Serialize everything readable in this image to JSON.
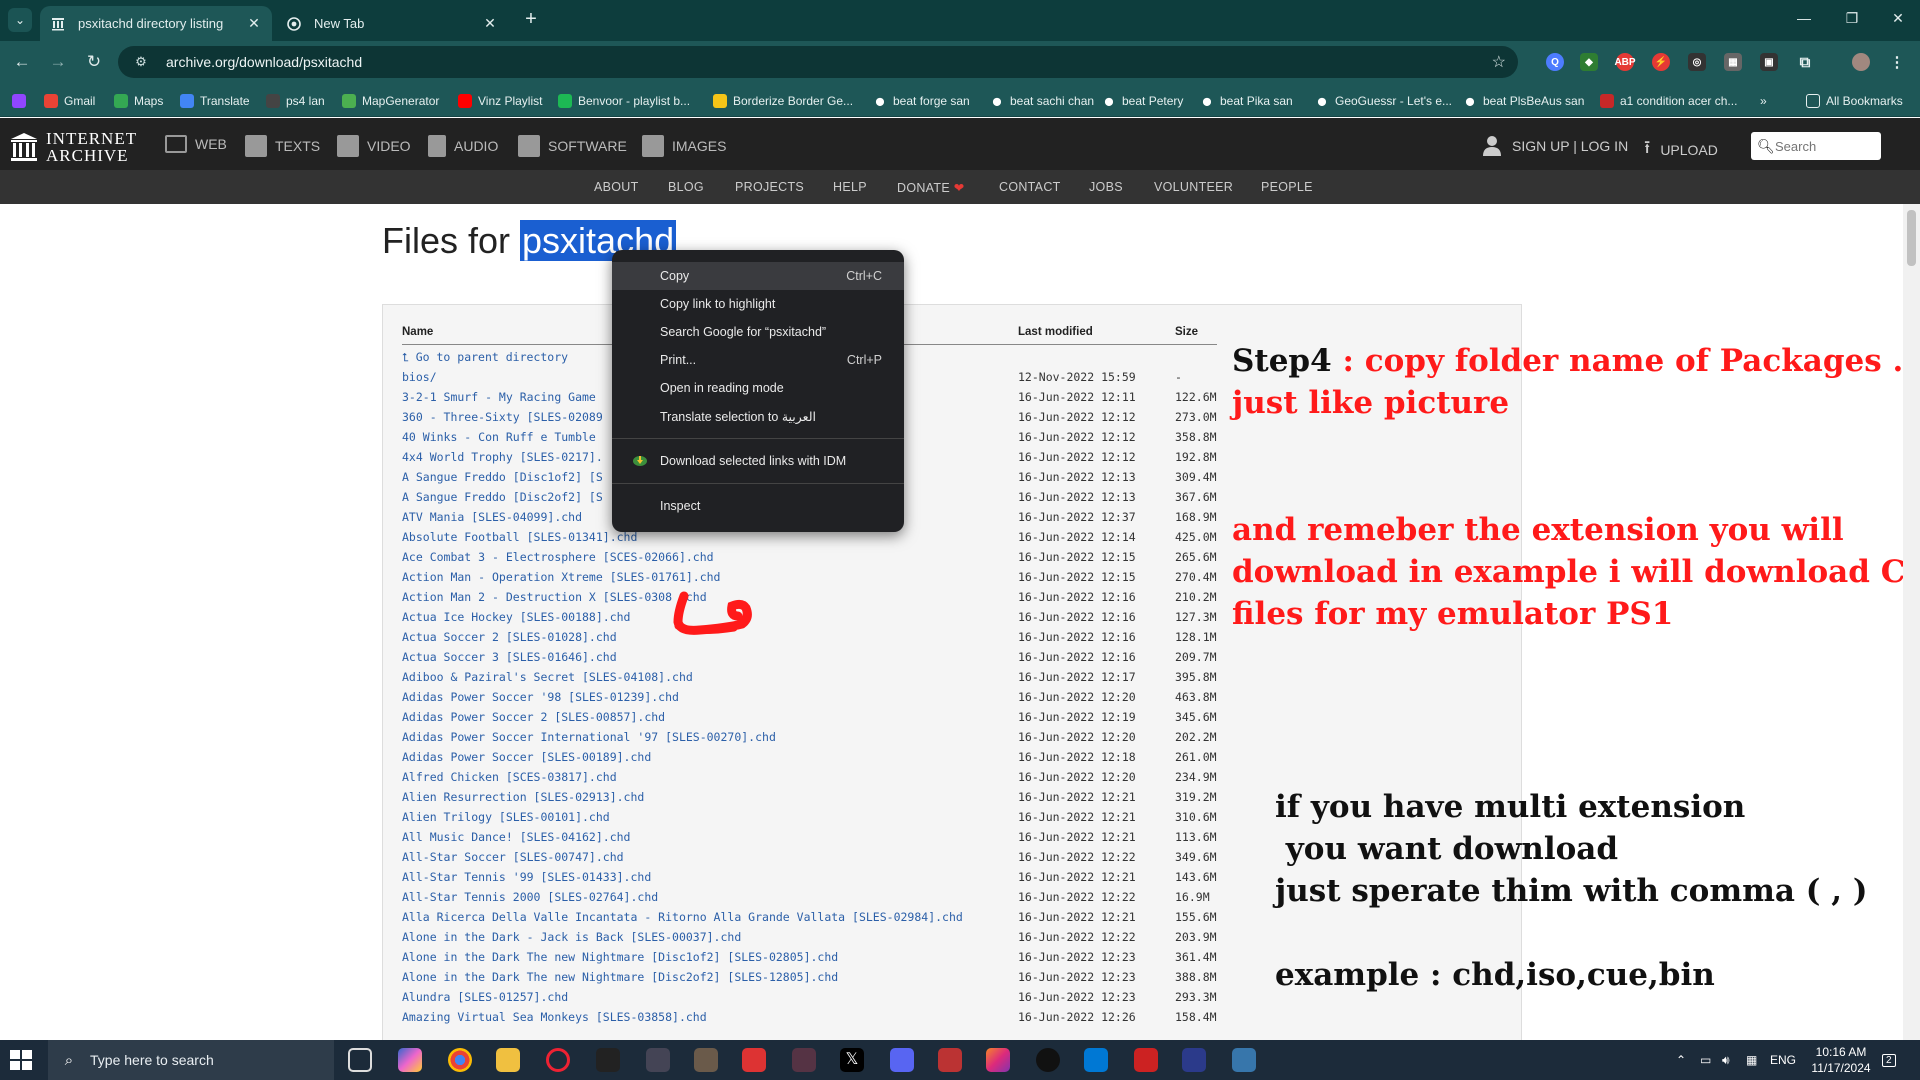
{
  "browser": {
    "tabs": [
      {
        "title": "psxitachd directory listing",
        "icon": "archive-icon",
        "active": true
      },
      {
        "title": "New Tab",
        "icon": "chrome-icon",
        "active": false
      }
    ],
    "url": "archive.org/download/psxitachd"
  },
  "bookmarks": {
    "items": [
      {
        "label": "",
        "icon": "twitch-icon",
        "color": "#9146ff"
      },
      {
        "label": "Gmail",
        "icon": "gmail-icon",
        "color": "#ea4335"
      },
      {
        "label": "Maps",
        "icon": "maps-icon",
        "color": "#34a853"
      },
      {
        "label": "Translate",
        "icon": "translate-icon",
        "color": "#4285f4"
      },
      {
        "label": "ps4 lan",
        "icon": "ps4-icon",
        "color": "#444444"
      },
      {
        "label": "MapGenerator",
        "icon": "globe-icon",
        "color": "#4caf50"
      },
      {
        "label": "Vinz Playlist",
        "icon": "youtube-icon",
        "color": "#ff0000"
      },
      {
        "label": "Benvoor - playlist b...",
        "icon": "spotify-icon",
        "color": "#1db954"
      },
      {
        "label": "Borderize Border Ge...",
        "icon": "emoji-icon",
        "color": "#f5c518"
      },
      {
        "label": "beat forge san",
        "icon": "pin-icon",
        "color": "#ffffff"
      },
      {
        "label": "beat sachi chan",
        "icon": "pin-icon",
        "color": "#ffffff"
      },
      {
        "label": "beat Petery",
        "icon": "pin-icon",
        "color": "#ffffff"
      },
      {
        "label": "beat Pika san",
        "icon": "pin-icon",
        "color": "#ffffff"
      },
      {
        "label": "GeoGuessr - Let's e...",
        "icon": "pin-icon",
        "color": "#ffffff"
      },
      {
        "label": "beat PlsBeAus san",
        "icon": "pin-icon",
        "color": "#ffffff"
      },
      {
        "label": "a1 condition acer ch...",
        "icon": "acer-icon",
        "color": "#c62828"
      }
    ],
    "more": "»",
    "all_bookmarks": "All Bookmarks"
  },
  "ia": {
    "logo_line1": "INTERNET",
    "logo_line2": "ARCHIVE",
    "nav": [
      "WEB",
      "TEXTS",
      "VIDEO",
      "AUDIO",
      "SOFTWARE",
      "IMAGES"
    ],
    "signup": "SIGN UP | LOG IN",
    "upload": "UPLOAD",
    "search_placeholder": "Search",
    "sub": [
      "ABOUT",
      "BLOG",
      "PROJECTS",
      "HELP",
      "DONATE",
      "CONTACT",
      "JOBS",
      "VOLUNTEER",
      "PEOPLE"
    ],
    "donate_heart": "❤"
  },
  "page": {
    "title_prefix": "Files for ",
    "title_selected": "psxitachd"
  },
  "listing": {
    "col_name": "Name",
    "col_modified": "Last modified",
    "col_size": "Size",
    "parent": "Go to parent directory",
    "rows": [
      {
        "name": "bios/",
        "date": "12-Nov-2022 15:59",
        "size": "-"
      },
      {
        "name": "3-2-1 Smurf - My Racing Game",
        "date": "16-Jun-2022 12:11",
        "size": "122.6M"
      },
      {
        "name": "360 - Three-Sixty [SLES-02089",
        "date": "16-Jun-2022 12:12",
        "size": "273.0M"
      },
      {
        "name": "40 Winks - Con Ruff e Tumble",
        "date": "16-Jun-2022 12:12",
        "size": "358.8M"
      },
      {
        "name": "4x4 World Trophy [SLES-0217].",
        "date": "16-Jun-2022 12:12",
        "size": "192.8M"
      },
      {
        "name": "A Sangue Freddo [Disc1of2] [S",
        "date": "16-Jun-2022 12:13",
        "size": "309.4M"
      },
      {
        "name": "A Sangue Freddo [Disc2of2] [S",
        "date": "16-Jun-2022 12:13",
        "size": "367.6M"
      },
      {
        "name": "ATV Mania [SLES-04099].chd",
        "date": "16-Jun-2022 12:37",
        "size": "168.9M"
      },
      {
        "name": "Absolute Football [SLES-01341].chd",
        "date": "16-Jun-2022 12:14",
        "size": "425.0M"
      },
      {
        "name": "Ace Combat 3 - Electrosphere [SCES-02066].chd",
        "date": "16-Jun-2022 12:15",
        "size": "265.6M"
      },
      {
        "name": "Action Man - Operation Xtreme [SLES-01761].chd",
        "date": "16-Jun-2022 12:15",
        "size": "270.4M"
      },
      {
        "name": "Action Man 2 - Destruction X [SLES-0308 .chd",
        "date": "16-Jun-2022 12:16",
        "size": "210.2M"
      },
      {
        "name": "Actua Ice Hockey [SLES-00188].chd",
        "date": "16-Jun-2022 12:16",
        "size": "127.3M"
      },
      {
        "name": "Actua Soccer 2 [SLES-01028].chd",
        "date": "16-Jun-2022 12:16",
        "size": "128.1M"
      },
      {
        "name": "Actua Soccer 3 [SLES-01646].chd",
        "date": "16-Jun-2022 12:16",
        "size": "209.7M"
      },
      {
        "name": "Adiboo & Paziral's Secret [SLES-04108].chd",
        "date": "16-Jun-2022 12:17",
        "size": "395.8M"
      },
      {
        "name": "Adidas Power Soccer '98 [SLES-01239].chd",
        "date": "16-Jun-2022 12:20",
        "size": "463.8M"
      },
      {
        "name": "Adidas Power Soccer 2 [SLES-00857].chd",
        "date": "16-Jun-2022 12:19",
        "size": "345.6M"
      },
      {
        "name": "Adidas Power Soccer International '97 [SLES-00270].chd",
        "date": "16-Jun-2022 12:20",
        "size": "202.2M"
      },
      {
        "name": "Adidas Power Soccer [SLES-00189].chd",
        "date": "16-Jun-2022 12:18",
        "size": "261.0M"
      },
      {
        "name": "Alfred Chicken [SCES-03817].chd",
        "date": "16-Jun-2022 12:20",
        "size": "234.9M"
      },
      {
        "name": "Alien Resurrection [SLES-02913].chd",
        "date": "16-Jun-2022 12:21",
        "size": "319.2M"
      },
      {
        "name": "Alien Trilogy [SLES-00101].chd",
        "date": "16-Jun-2022 12:21",
        "size": "310.6M"
      },
      {
        "name": "All Music Dance! [SLES-04162].chd",
        "date": "16-Jun-2022 12:21",
        "size": "113.6M"
      },
      {
        "name": "All-Star Soccer [SLES-00747].chd",
        "date": "16-Jun-2022 12:22",
        "size": "349.6M"
      },
      {
        "name": "All-Star Tennis '99 [SLES-01433].chd",
        "date": "16-Jun-2022 12:21",
        "size": "143.6M"
      },
      {
        "name": "All-Star Tennis 2000 [SLES-02764].chd",
        "date": "16-Jun-2022 12:22",
        "size": "16.9M"
      },
      {
        "name": "Alla Ricerca Della Valle Incantata - Ritorno Alla Grande Vallata [SLES-02984].chd",
        "date": "16-Jun-2022 12:21",
        "size": "155.6M"
      },
      {
        "name": "Alone in the Dark - Jack is Back [SLES-00037].chd",
        "date": "16-Jun-2022 12:22",
        "size": "203.9M"
      },
      {
        "name": "Alone in the Dark The new Nightmare [Disc1of2] [SLES-02805].chd",
        "date": "16-Jun-2022 12:23",
        "size": "361.4M"
      },
      {
        "name": "Alone in the Dark The new Nightmare [Disc2of2] [SLES-12805].chd",
        "date": "16-Jun-2022 12:23",
        "size": "388.8M"
      },
      {
        "name": "Alundra [SLES-01257].chd",
        "date": "16-Jun-2022 12:23",
        "size": "293.3M"
      },
      {
        "name": "Amazing Virtual Sea Monkeys [SLES-03858].chd",
        "date": "16-Jun-2022 12:26",
        "size": "158.4M"
      }
    ]
  },
  "context_menu": {
    "items": [
      {
        "label": "Copy",
        "shortcut": "Ctrl+C",
        "hover": true
      },
      {
        "label": "Copy link to highlight",
        "shortcut": ""
      },
      {
        "label": "Search Google for “psxitachd”",
        "shortcut": ""
      },
      {
        "label": "Print...",
        "shortcut": "Ctrl+P"
      },
      {
        "label": "Open in reading mode",
        "shortcut": ""
      },
      {
        "label": "Translate selection to العربية",
        "shortcut": ""
      },
      {
        "label": "Download selected links with IDM",
        "shortcut": ""
      },
      {
        "label": "Inspect",
        "shortcut": ""
      }
    ]
  },
  "annotations": {
    "step4_label": "Step4",
    "step4_text": " : copy folder name of Packages .",
    "step4_line2": "just  like picture",
    "ext_line1": "and remeber the extension you will",
    "ext_line2": "download in example i will download CHD",
    "ext_line3": "files for my emulator PS1",
    "multi_line1": "if you have multi extension",
    "multi_line2": " you want download",
    "multi_line3": "just sperate thim with comma ( , )",
    "example": "example : chd,iso,cue,bin"
  },
  "taskbar": {
    "search_placeholder": "Type here to search",
    "lang": "ENG",
    "time": "10:16 AM",
    "date": "11/17/2024",
    "notif_count": "2"
  },
  "colors": {
    "tab_bg": "#0d3d3d",
    "toolbar_bg": "#1e5757",
    "ia_header": "#222222",
    "link": "#2b5fa8",
    "annotation_red": "#ff1a1a",
    "selection": "#1a5fd1"
  }
}
